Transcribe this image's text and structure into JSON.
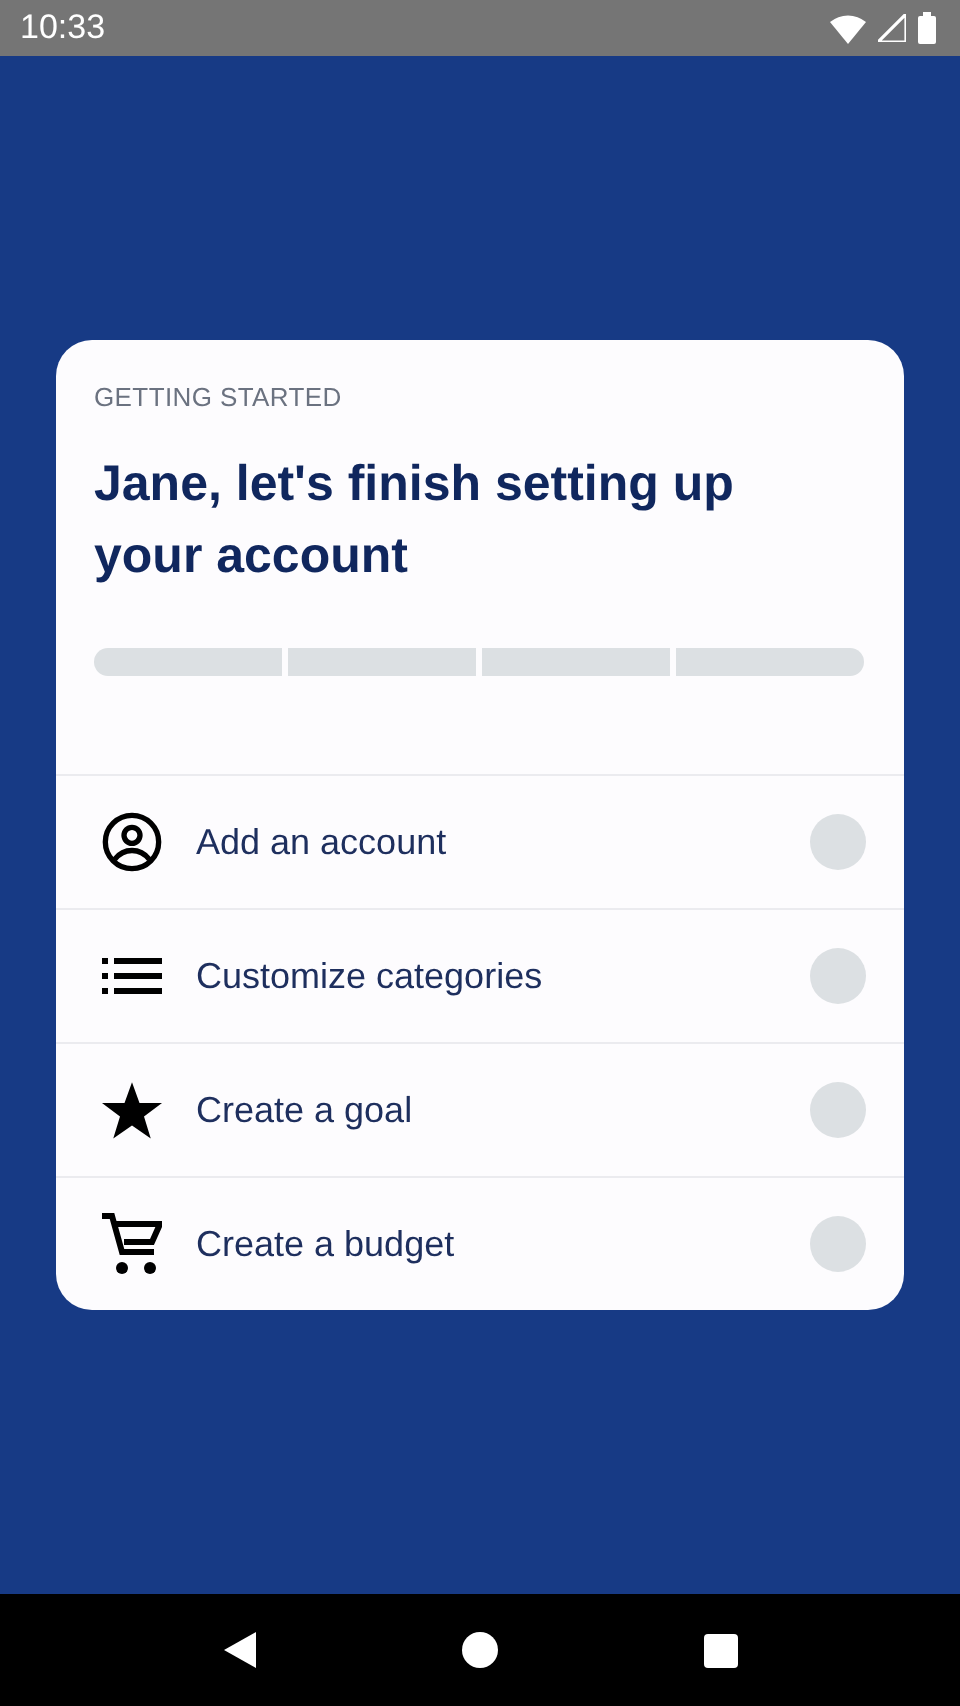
{
  "status_bar": {
    "time": "10:33"
  },
  "card": {
    "eyebrow": "GETTING STARTED",
    "title": "Jane, let's finish setting up your account",
    "progress": [
      {
        "done": false
      },
      {
        "done": false
      },
      {
        "done": false
      },
      {
        "done": false
      }
    ],
    "tasks": [
      {
        "kind": "account",
        "label": "Add an account",
        "done": false
      },
      {
        "kind": "list",
        "label": "Customize categories",
        "done": false
      },
      {
        "kind": "star",
        "label": "Create a goal",
        "done": false
      },
      {
        "kind": "cart",
        "label": "Create a budget",
        "done": false
      }
    ]
  }
}
